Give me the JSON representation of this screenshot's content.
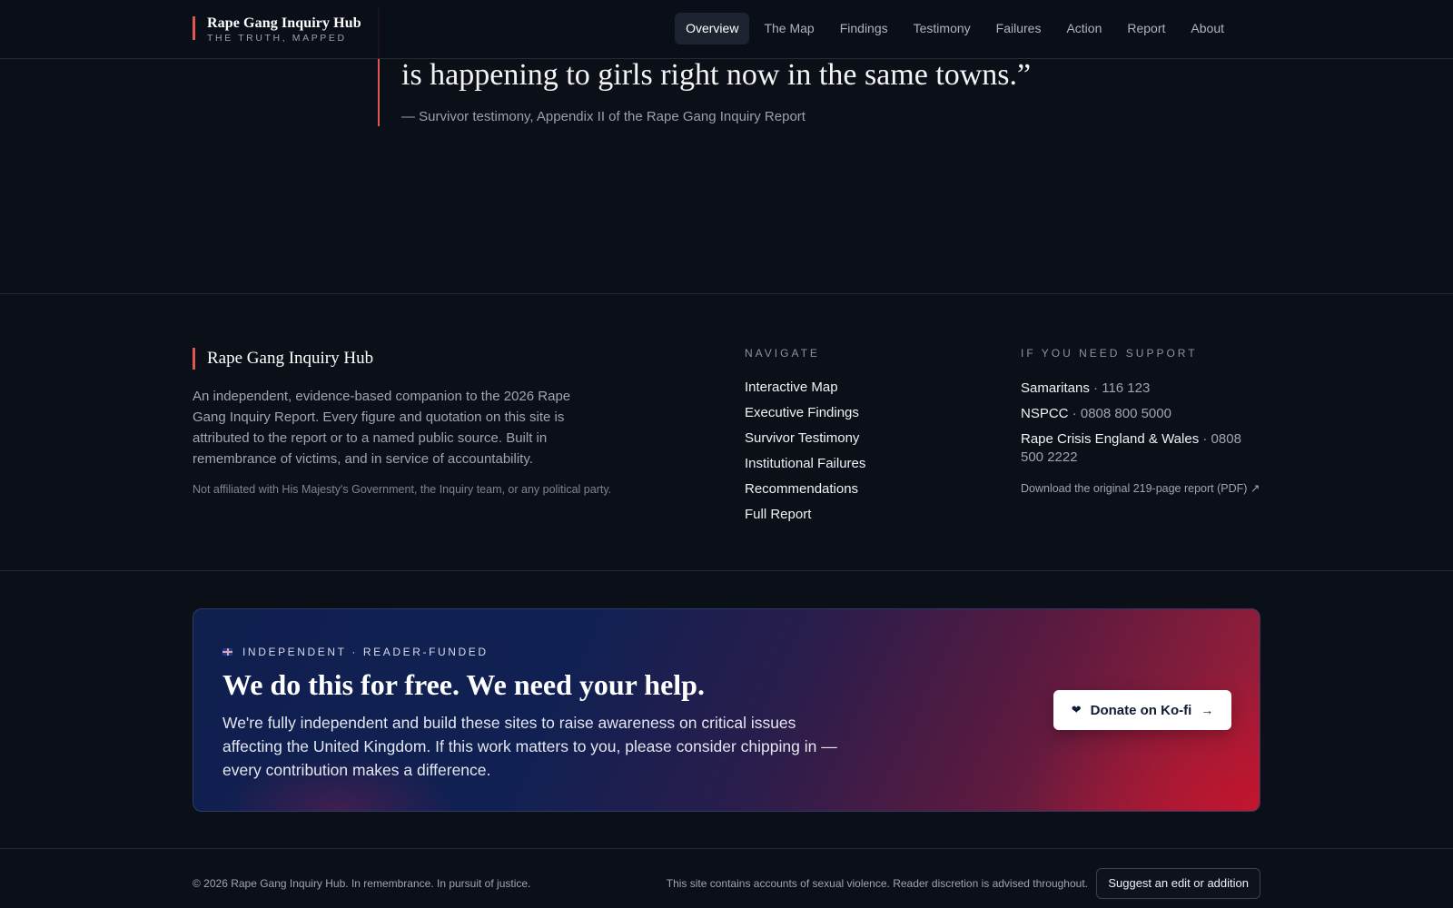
{
  "header": {
    "brand_title": "Rape Gang Inquiry Hub",
    "brand_tagline": "THE TRUTH, MAPPED",
    "nav": [
      {
        "label": "Overview",
        "active": true
      },
      {
        "label": "The Map"
      },
      {
        "label": "Findings"
      },
      {
        "label": "Testimony"
      },
      {
        "label": "Failures"
      },
      {
        "label": "Action"
      },
      {
        "label": "Report"
      },
      {
        "label": "About"
      }
    ]
  },
  "quote": {
    "line": "is happening to girls right now in the same towns.”",
    "attribution": "— Survivor testimony, Appendix II of the Rape Gang Inquiry Report"
  },
  "footer": {
    "brand": "Rape Gang Inquiry Hub",
    "description": "An independent, evidence-based companion to the 2026 Rape Gang Inquiry Report. Every figure and quotation on this site is attributed to the report or to a named public source. Built in remembrance of victims, and in service of accountability.",
    "disclaimer": "Not affiliated with His Majesty's Government, the Inquiry team, or any political party.",
    "navigate": {
      "title": "NAVIGATE",
      "links": [
        "Interactive Map",
        "Executive Findings",
        "Survivor Testimony",
        "Institutional Failures",
        "Recommendations",
        "Full Report"
      ]
    },
    "support": {
      "title": "IF YOU NEED SUPPORT",
      "lines": [
        {
          "name": "Samaritans",
          "number": "116 123"
        },
        {
          "name": "NSPCC",
          "number": "0808 800 5000"
        },
        {
          "name": "Rape Crisis England & Wales",
          "number": "0808 500 2222"
        }
      ],
      "download": "Download the original 219-page report (PDF) ↗"
    }
  },
  "banner": {
    "kicker": "INDEPENDENT · READER-FUNDED",
    "title": "We do this for free. We need your help.",
    "text": "We're fully independent and build these sites to raise awareness on critical issues affecting the United Kingdom. If this work matters to you, please consider chipping in — every contribution makes a difference.",
    "button_label": "Donate on Ko-fi",
    "heart_icon": "❤",
    "arrow_icon": "→"
  },
  "bottom": {
    "copyright": "© 2026 Rape Gang Inquiry Hub. In remembrance. In pursuit of justice.",
    "discretion": "This site contains accounts of sexual violence. Reader discretion is advised throughout.",
    "suggest_button": "Suggest an edit or addition"
  },
  "colors": {
    "accent": "#e0574f",
    "background": "#0b0f18",
    "banner_blue": "#0f1f4e",
    "banner_red": "#a81a35"
  }
}
